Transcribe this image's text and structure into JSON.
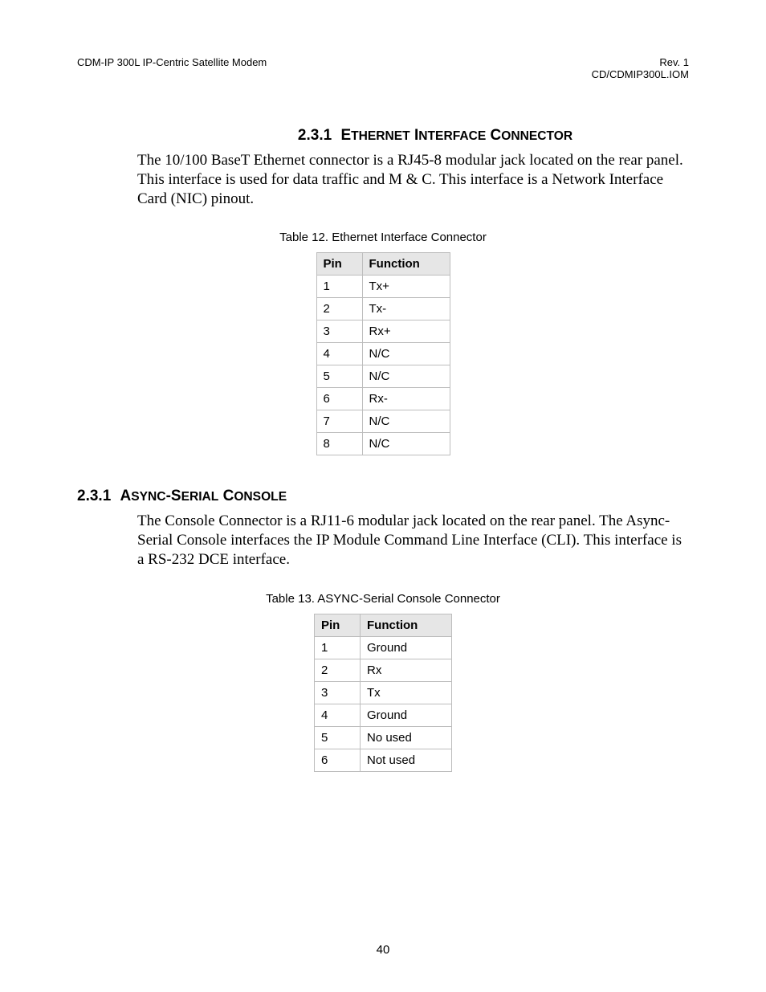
{
  "header": {
    "left": "CDM-IP 300L IP-Centric Satellite Modem",
    "right_line1": "Rev. 1",
    "right_line2": "CD/CDMIP300L.IOM"
  },
  "section1": {
    "number": "2.3.1",
    "title": "Ethernet Interface Connector",
    "body": "The 10/100 BaseT Ethernet connector is a RJ45-8 modular jack located on the rear panel. This interface is used for data traffic and M & C. This interface is a Network Interface Card (NIC) pinout.",
    "table_caption": "Table 12. Ethernet Interface Connector",
    "table_headers": {
      "pin": "Pin",
      "function": "Function"
    },
    "rows": [
      {
        "pin": "1",
        "function": "Tx+"
      },
      {
        "pin": "2",
        "function": "Tx-"
      },
      {
        "pin": "3",
        "function": "Rx+"
      },
      {
        "pin": "4",
        "function": "N/C"
      },
      {
        "pin": "5",
        "function": "N/C"
      },
      {
        "pin": "6",
        "function": "Rx-"
      },
      {
        "pin": "7",
        "function": "N/C"
      },
      {
        "pin": "8",
        "function": "N/C"
      }
    ]
  },
  "section2": {
    "number": "2.3.1",
    "title": "Async-Serial Console",
    "body": "The Console Connector is a RJ11-6 modular jack located on the rear panel. The Async-Serial Console interfaces the IP Module Command Line Interface (CLI). This interface is a RS-232 DCE interface.",
    "table_caption": "Table 13. ASYNC-Serial Console Connector",
    "table_headers": {
      "pin": "Pin",
      "function": "Function"
    },
    "rows": [
      {
        "pin": "1",
        "function": "Ground"
      },
      {
        "pin": "2",
        "function": "Rx"
      },
      {
        "pin": "3",
        "function": "Tx"
      },
      {
        "pin": "4",
        "function": "Ground"
      },
      {
        "pin": "5",
        "function": "No used"
      },
      {
        "pin": "6",
        "function": "Not used"
      }
    ]
  },
  "page_number": "40"
}
